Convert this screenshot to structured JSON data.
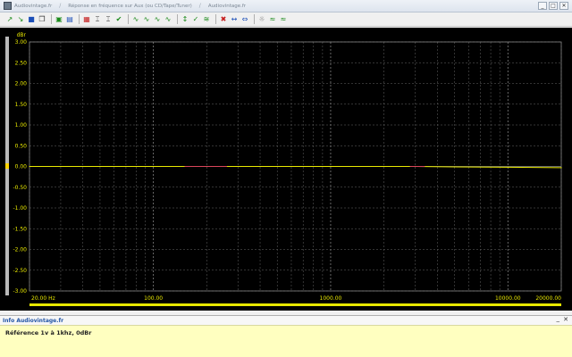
{
  "window": {
    "tabs": [
      "Audiovintage.fr",
      "Réponse en fréquence sur Aux (ou CD/Tape/Tuner)",
      "Audiovintage.fr"
    ],
    "separator": "/",
    "controls": [
      "_",
      "□",
      "✕"
    ]
  },
  "toolbar": {
    "icons": [
      "curve-icon",
      "curve-icon",
      "save-icon",
      "copy-icon",
      "paste-icon",
      "image-icon",
      "chart-icon",
      "plot-icon",
      "zoom-icon",
      "cursor-icon",
      "cursor-icon",
      "cursor-icon",
      "cursor-icon",
      "marker-icon",
      "marker-icon",
      "marker-icon",
      "marker-icon",
      "sine-icon",
      "sine-icon",
      "sine-icon",
      "eq-icon",
      "scale-icon",
      "scale-icon",
      "settings-icon",
      "settings-icon"
    ]
  },
  "chart_data": {
    "type": "line",
    "ylabel": "dBr",
    "xscale": "log",
    "xlim": [
      20,
      20000
    ],
    "ylim": [
      -3,
      3
    ],
    "y_ticks": [
      "3.00",
      "2.50",
      "2.00",
      "1.50",
      "1.00",
      "0.50",
      "0.00",
      "-0.50",
      "-1.00",
      "-1.50",
      "-2.00",
      "-2.50",
      "-3.00"
    ],
    "x_tick_labels": [
      "20.00 Hz",
      "100.00",
      "1000.00",
      "10000.00",
      "20000.00"
    ],
    "grid": true,
    "series": [
      {
        "color": "#e8e800",
        "x": [
          20,
          50,
          100,
          200,
          500,
          1000,
          2000,
          3000,
          5000,
          10000,
          20000
        ],
        "y": [
          0,
          0,
          0,
          0,
          0,
          0,
          0,
          0,
          -0.01,
          -0.02,
          -0.03
        ]
      }
    ],
    "colors": {
      "background": "#000000",
      "grid": "#606060",
      "axis_text": "#e8e800",
      "zero_line": "#d0d0d0",
      "highlight": "#d4107a"
    }
  },
  "info": {
    "title": "Info Audiovintage.fr",
    "text": "Référence 1v à 1khz, 0dBr",
    "close": "✕",
    "pin": "_"
  }
}
